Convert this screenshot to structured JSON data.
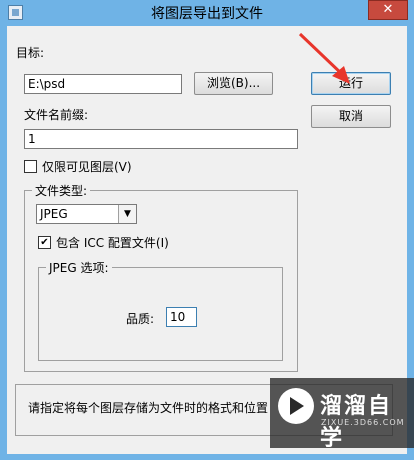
{
  "window": {
    "title": "将图层导出到文件",
    "close_glyph": "✕"
  },
  "target": {
    "label": "目标:",
    "path_value": "E:\\psd",
    "browse_label": "浏览(B)..."
  },
  "prefix": {
    "label": "文件名前缀:",
    "value": "1"
  },
  "visible_only": {
    "label": "仅限可见图层(V)",
    "checked": false
  },
  "file_type": {
    "group_label": "文件类型:",
    "selected": "JPEG",
    "icc": {
      "label": "包含 ICC 配置文件(I)",
      "checked": true,
      "check_glyph": "✔"
    },
    "jpeg_options": {
      "group_label": "JPEG 选项:",
      "quality_label": "品质:",
      "quality_value": "10"
    }
  },
  "actions": {
    "run_label": "运行",
    "cancel_label": "取消"
  },
  "status_text": "请指定将每个图层存储为文件时的格式和位置",
  "watermark": {
    "cn": "溜溜自学",
    "en": "ZIXUE.3D66.COM"
  },
  "colors": {
    "titlebar": "#6fb3e6",
    "close": "#c74a3e",
    "arrow": "#e8352b"
  }
}
